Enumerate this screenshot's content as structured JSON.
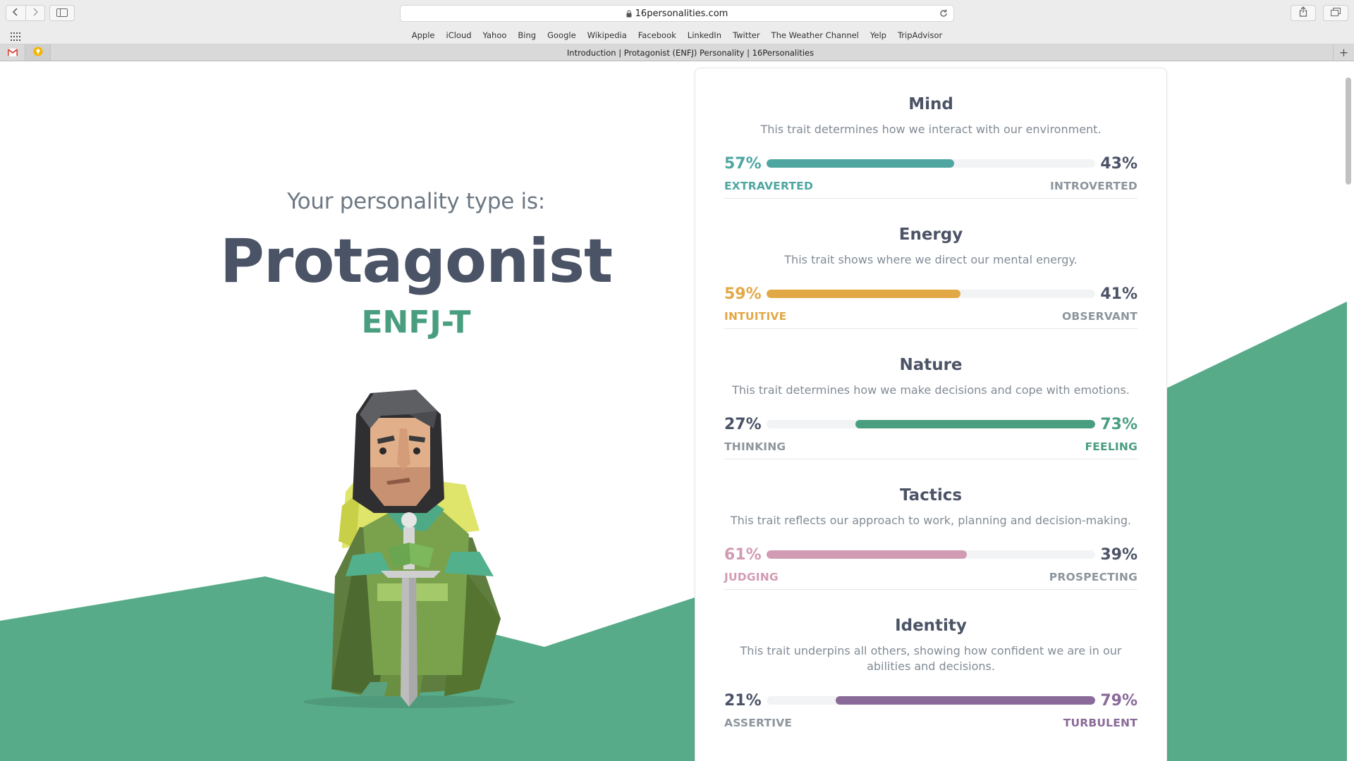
{
  "browser": {
    "url": "16personalities.com",
    "tab_title": "Introduction | Protagonist (ENFJ) Personality | 16Personalities",
    "favorites": [
      "Apple",
      "iCloud",
      "Yahoo",
      "Bing",
      "Google",
      "Wikipedia",
      "Facebook",
      "LinkedIn",
      "Twitter",
      "The Weather Channel",
      "Yelp",
      "TripAdvisor"
    ],
    "new_tab_label": "+"
  },
  "hero": {
    "intro": "Your personality type is:",
    "type_name": "Protagonist",
    "type_code": "ENFJ-T"
  },
  "colors": {
    "green_bg": "#58ab89",
    "mind": "#4fa6a0",
    "energy": "#e3a846",
    "nature": "#4a9e80",
    "tactics": "#d19bb3",
    "identity": "#8a6a99",
    "text_dark": "#4b5366",
    "text_muted": "#8d959d"
  },
  "traits": [
    {
      "name": "Mind",
      "description": "This trait determines how we interact with our environment.",
      "left_pct": "57%",
      "right_pct": "43%",
      "left_label": "EXTRAVERTED",
      "right_label": "INTROVERTED",
      "value": 57,
      "dominant": "left",
      "color": "#4fa6a0"
    },
    {
      "name": "Energy",
      "description": "This trait shows where we direct our mental energy.",
      "left_pct": "59%",
      "right_pct": "41%",
      "left_label": "INTUITIVE",
      "right_label": "OBSERVANT",
      "value": 59,
      "dominant": "left",
      "color": "#e3a846"
    },
    {
      "name": "Nature",
      "description": "This trait determines how we make decisions and cope with emotions.",
      "left_pct": "27%",
      "right_pct": "73%",
      "left_label": "THINKING",
      "right_label": "FEELING",
      "value": 73,
      "dominant": "right",
      "color": "#4a9e80"
    },
    {
      "name": "Tactics",
      "description": "This trait reflects our approach to work, planning and decision-making.",
      "left_pct": "61%",
      "right_pct": "39%",
      "left_label": "JUDGING",
      "right_label": "PROSPECTING",
      "value": 61,
      "dominant": "left",
      "color": "#d19bb3"
    },
    {
      "name": "Identity",
      "description": "This trait underpins all others, showing how confident we are in our abilities and decisions.",
      "left_pct": "21%",
      "right_pct": "79%",
      "left_label": "ASSERTIVE",
      "right_label": "TURBULENT",
      "value": 79,
      "dominant": "right",
      "color": "#8a6a99"
    }
  ]
}
